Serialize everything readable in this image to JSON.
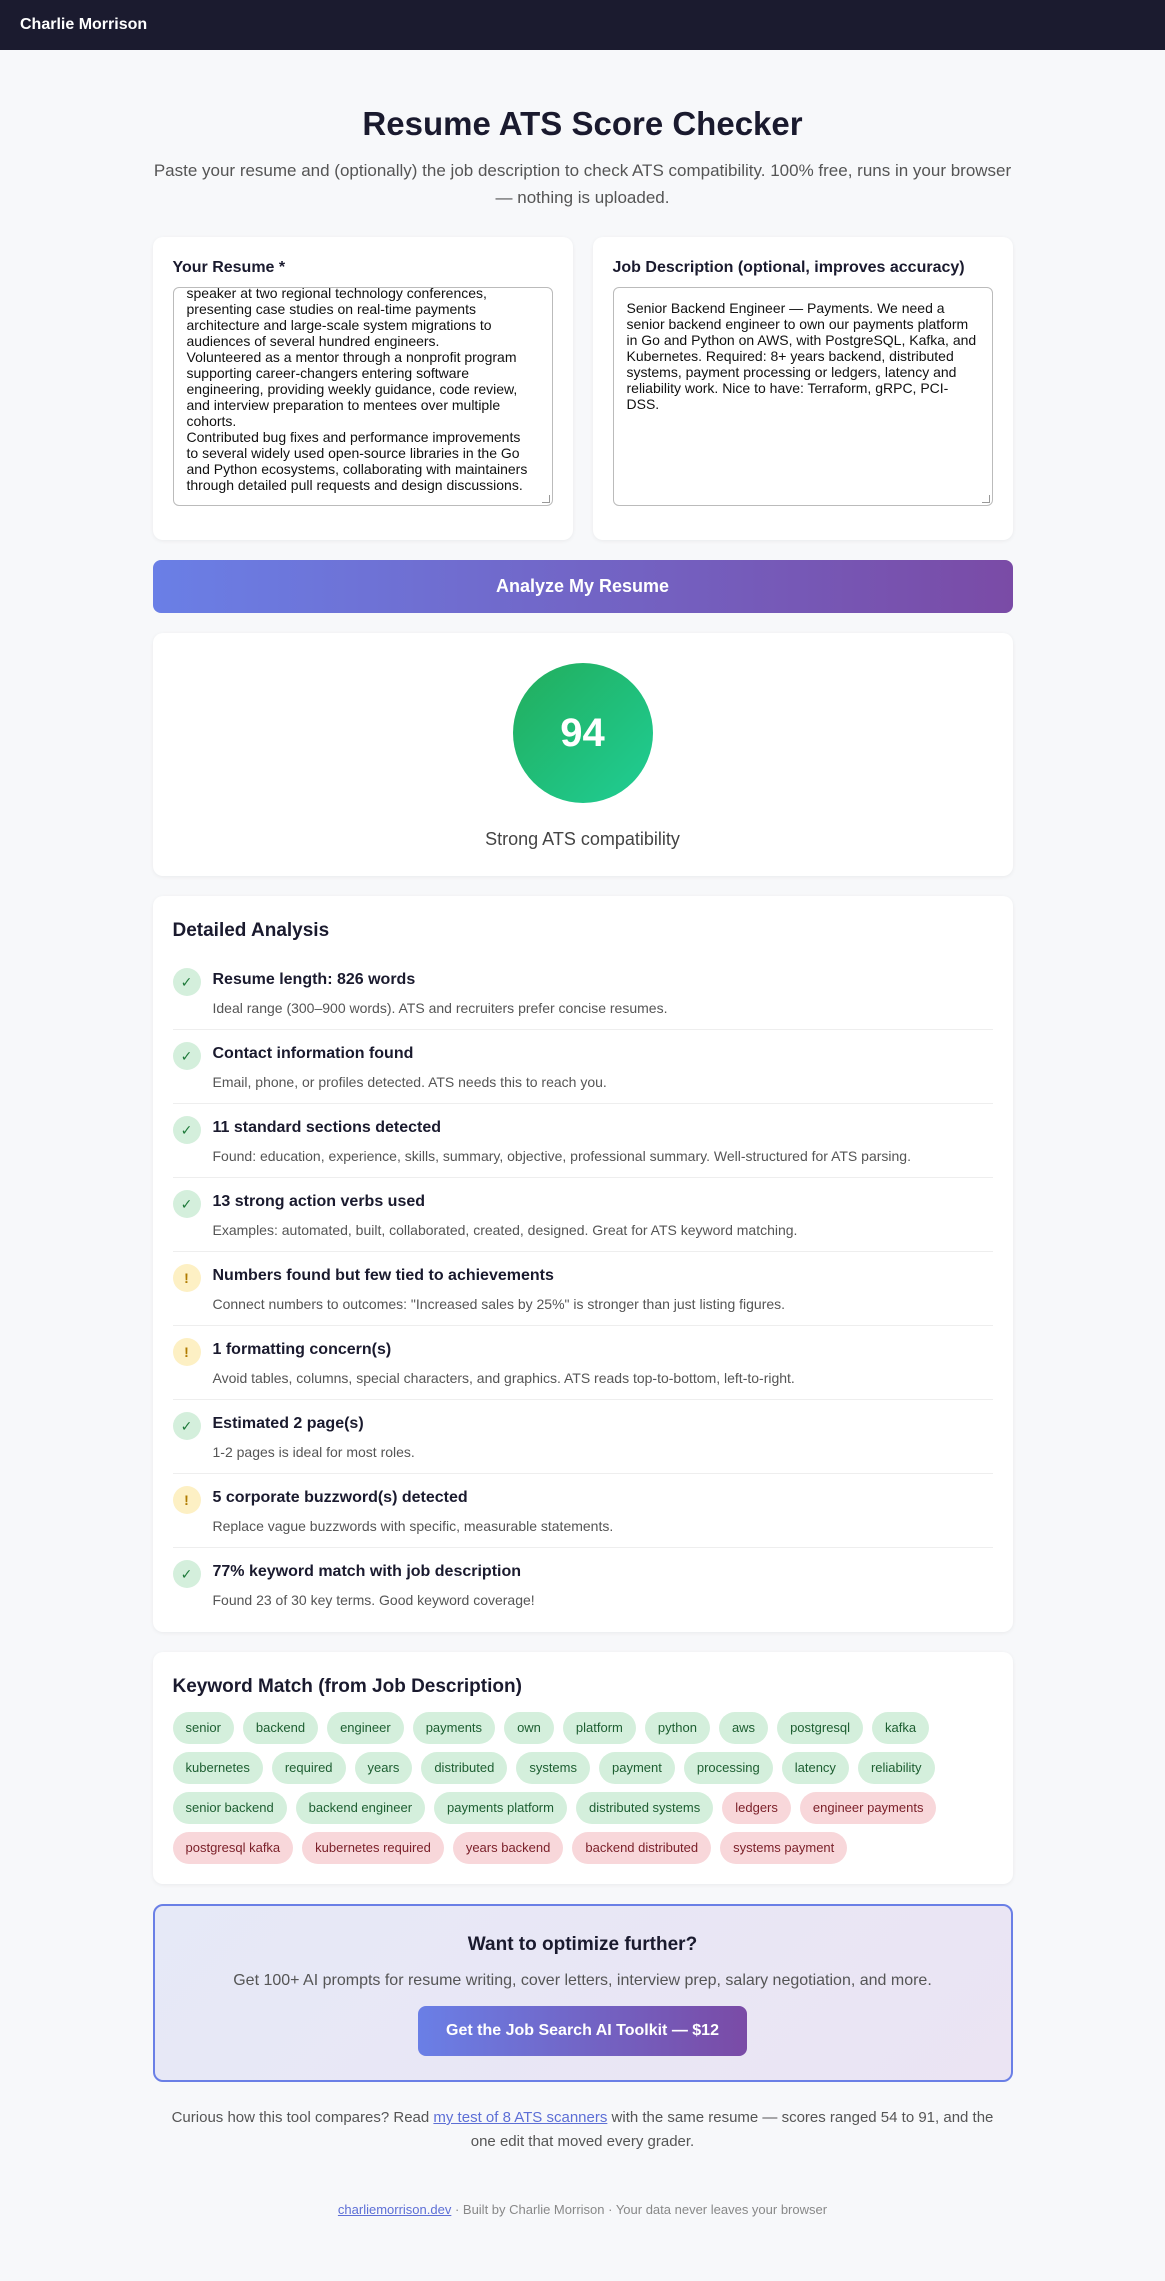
{
  "header": {
    "brand": "Charlie Morrison"
  },
  "page": {
    "title": "Resume ATS Score Checker",
    "subtitle": "Paste your resume and (optionally) the job description to check ATS compatibility. 100% free, runs in your browser — nothing is uploaded."
  },
  "resume_input": {
    "label": "Your Resume *",
    "value_lines": [
      "speaker at two regional technology conferences,",
      "presenting case studies on real-time payments",
      "architecture and large-scale system migrations to",
      "audiences of several hundred engineers.",
      "Volunteered as a mentor through a nonprofit program",
      "supporting career-changers entering software",
      "engineering, providing weekly guidance, code review,",
      "and interview preparation to mentees over multiple",
      "cohorts.",
      "Contributed bug fixes and performance improvements",
      "to several widely used open-source libraries in the Go",
      "and Python ecosystems, collaborating with maintainers",
      "through detailed pull requests and design discussions."
    ]
  },
  "job_input": {
    "label": "Job Description (optional, improves accuracy)",
    "value": "Senior Backend Engineer — Payments. We need a senior backend engineer to own our payments platform in Go and Python on AWS, with PostgreSQL, Kafka, and Kubernetes. Required: 8+ years backend, distributed systems, payment processing or ledgers, latency and reliability work. Nice to have: Terraform, gRPC, PCI-DSS."
  },
  "analyze_button": "Analyze My Resume",
  "score": {
    "value": "94",
    "label": "Strong ATS compatibility",
    "colors": [
      "#22ad5c",
      "#1fce95"
    ]
  },
  "analysis": {
    "title": "Detailed Analysis",
    "items": [
      {
        "status": "pass",
        "icon": "✓",
        "title": "Resume length: 826 words",
        "desc": "Ideal range (300–900 words). ATS and recruiters prefer concise resumes."
      },
      {
        "status": "pass",
        "icon": "✓",
        "title": "Contact information found",
        "desc": "Email, phone, or profiles detected. ATS needs this to reach you."
      },
      {
        "status": "pass",
        "icon": "✓",
        "title": "11 standard sections detected",
        "desc": "Found: education, experience, skills, summary, objective, professional summary. Well-structured for ATS parsing."
      },
      {
        "status": "pass",
        "icon": "✓",
        "title": "13 strong action verbs used",
        "desc": "Examples: automated, built, collaborated, created, designed. Great for ATS keyword matching."
      },
      {
        "status": "warn",
        "icon": "!",
        "title": "Numbers found but few tied to achievements",
        "desc": "Connect numbers to outcomes: \"Increased sales by 25%\" is stronger than just listing figures."
      },
      {
        "status": "warn",
        "icon": "!",
        "title": "1 formatting concern(s)",
        "desc": "Avoid tables, columns, special characters, and graphics. ATS reads top-to-bottom, left-to-right."
      },
      {
        "status": "pass",
        "icon": "✓",
        "title": "Estimated 2 page(s)",
        "desc": "1-2 pages is ideal for most roles."
      },
      {
        "status": "warn",
        "icon": "!",
        "title": "5 corporate buzzword(s) detected",
        "desc": "Replace vague buzzwords with specific, measurable statements."
      },
      {
        "status": "pass",
        "icon": "✓",
        "title": "77% keyword match with job description",
        "desc": "Found 23 of 30 key terms. Good keyword coverage!"
      }
    ]
  },
  "keywords": {
    "title": "Keyword Match (from Job Description)",
    "items": [
      {
        "text": "senior",
        "found": true
      },
      {
        "text": "backend",
        "found": true
      },
      {
        "text": "engineer",
        "found": true
      },
      {
        "text": "payments",
        "found": true
      },
      {
        "text": "own",
        "found": true
      },
      {
        "text": "platform",
        "found": true
      },
      {
        "text": "python",
        "found": true
      },
      {
        "text": "aws",
        "found": true
      },
      {
        "text": "postgresql",
        "found": true
      },
      {
        "text": "kafka",
        "found": true
      },
      {
        "text": "kubernetes",
        "found": true
      },
      {
        "text": "required",
        "found": true
      },
      {
        "text": "years",
        "found": true
      },
      {
        "text": "distributed",
        "found": true
      },
      {
        "text": "systems",
        "found": true
      },
      {
        "text": "payment",
        "found": true
      },
      {
        "text": "processing",
        "found": true
      },
      {
        "text": "latency",
        "found": true
      },
      {
        "text": "reliability",
        "found": true
      },
      {
        "text": "senior backend",
        "found": true
      },
      {
        "text": "backend engineer",
        "found": true
      },
      {
        "text": "payments platform",
        "found": true
      },
      {
        "text": "distributed systems",
        "found": true
      },
      {
        "text": "ledgers",
        "found": false
      },
      {
        "text": "engineer payments",
        "found": false
      },
      {
        "text": "postgresql kafka",
        "found": false
      },
      {
        "text": "kubernetes required",
        "found": false
      },
      {
        "text": "years backend",
        "found": false
      },
      {
        "text": "backend distributed",
        "found": false
      },
      {
        "text": "systems payment",
        "found": false
      }
    ]
  },
  "cta": {
    "title": "Want to optimize further?",
    "text": "Get 100+ AI prompts for resume writing, cover letters, interview prep, salary negotiation, and more.",
    "button": "Get the Job Search AI Toolkit — $12"
  },
  "compare": {
    "before": "Curious how this tool compares? Read ",
    "link": "my test of 8 ATS scanners",
    "after": " with the same resume — scores ranged 54 to 91, and the one edit that moved every grader."
  },
  "footer": {
    "link": "charliemorrison.dev",
    "text": " · Built by Charlie Morrison · Your data never leaves your browser"
  }
}
